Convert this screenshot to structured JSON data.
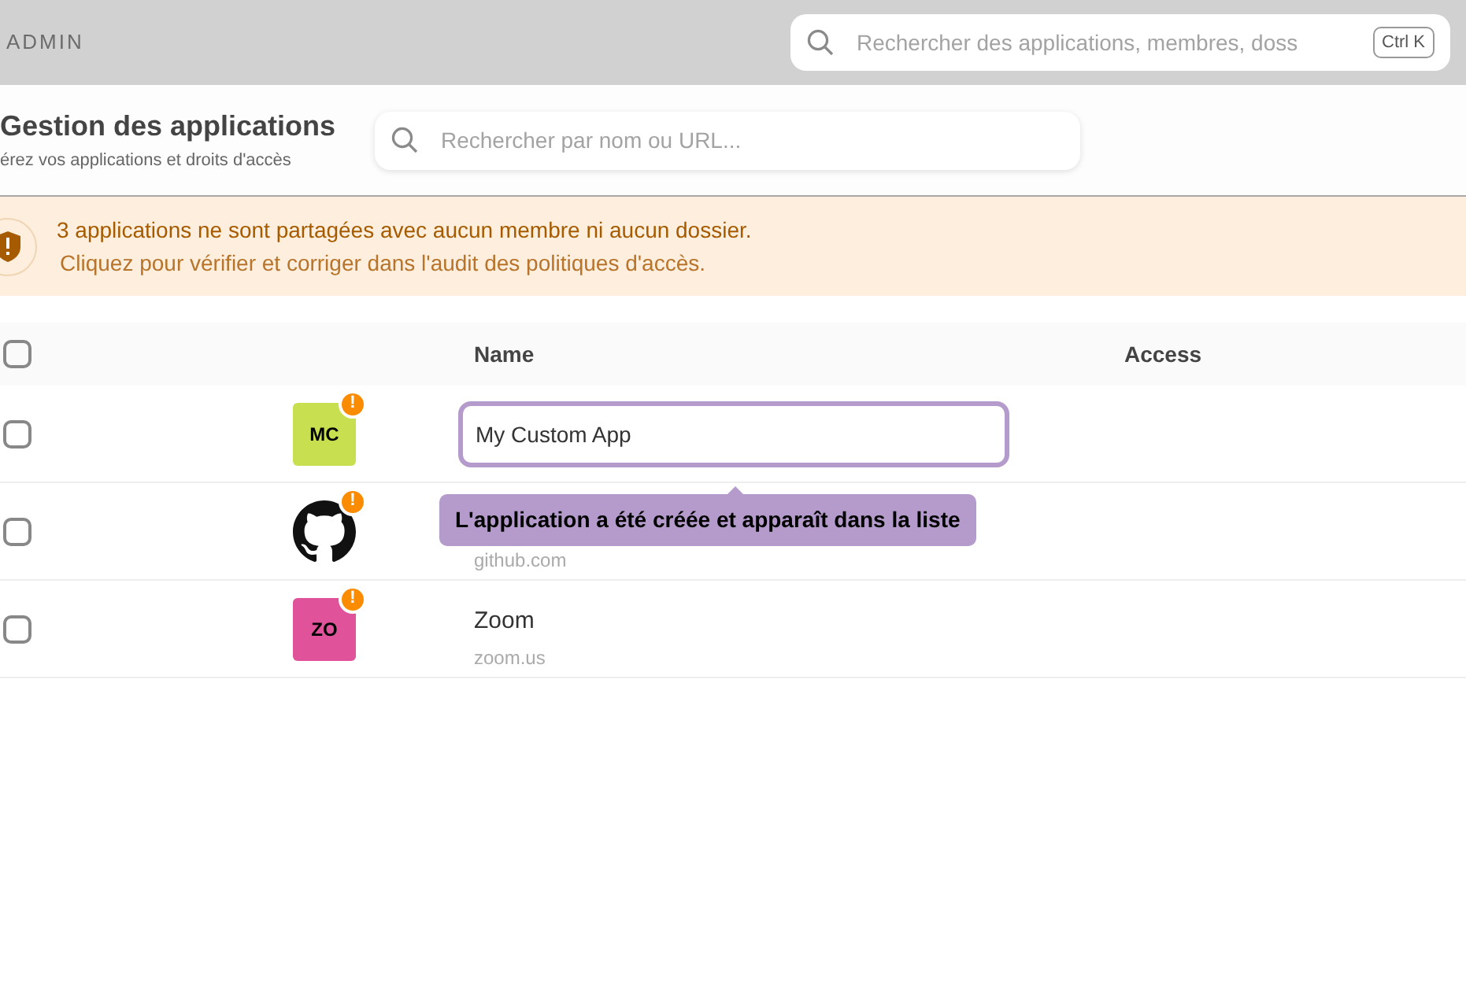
{
  "topbar": {
    "title": "ADMIN",
    "search": {
      "placeholder": "Rechercher des applications, membres, doss",
      "shortcut": "Ctrl K"
    }
  },
  "header": {
    "title": "Gestion des applications",
    "subtitle": "érez vos applications et droits d'accès",
    "search": {
      "placeholder": "Rechercher par nom ou URL..."
    }
  },
  "banner": {
    "title": "3 applications ne sont partagées avec aucun membre ni aucun dossier.",
    "text": "Cliquez pour vérifier et corriger dans l'audit des politiques d'accès."
  },
  "table": {
    "select_all": {
      "checked": false
    },
    "columns": [
      "Name",
      "Access"
    ],
    "rows": [
      {
        "checked": false,
        "logo": {
          "kind": "initials",
          "text": "MC",
          "color": "#c8e04f"
        },
        "warning": "!",
        "kind": "editing",
        "value": "My Custom App",
        "tooltip": "L'application a été créée et apparaît dans la liste"
      },
      {
        "checked": false,
        "logo": {
          "kind": "github"
        },
        "warning": "!",
        "kind": "normal",
        "url": "github.com"
      },
      {
        "checked": false,
        "logo": {
          "kind": "initials",
          "text": "ZO",
          "color": "#e0529a"
        },
        "warning": "!",
        "kind": "normal",
        "name": "Zoom",
        "url": "zoom.us"
      }
    ]
  }
}
